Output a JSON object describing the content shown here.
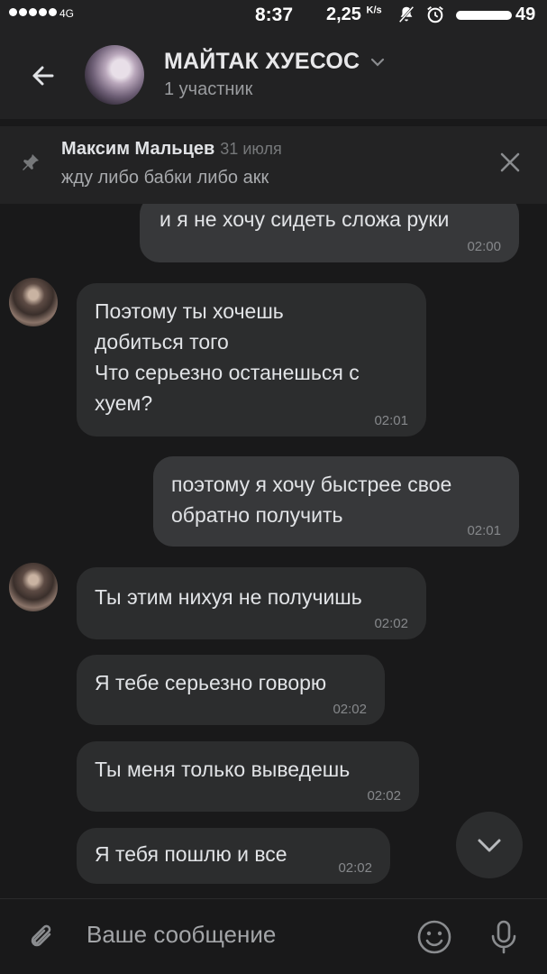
{
  "status_bar": {
    "network": "4G",
    "time": "8:37",
    "speed": "2,25",
    "speed_unit": "K/s",
    "battery": "49"
  },
  "header": {
    "title": "МАЙТАК ХУЕСОС",
    "subtitle": "1 участник"
  },
  "pinned": {
    "author": "Максим Мальцев",
    "date": "31 июля",
    "text": "жду либо бабки либо акк"
  },
  "messages": [
    {
      "dir": "out",
      "text": "и я не хочу сидеть сложа руки",
      "time": "02:00"
    },
    {
      "dir": "in",
      "text": "Поэтому ты хочешь\nдобиться того\nЧто серьезно останешься с\nхуем?",
      "time": "02:01"
    },
    {
      "dir": "out",
      "text": "поэтому я хочу быстрее свое\nобратно получить",
      "time": "02:01"
    },
    {
      "dir": "in",
      "text": "Ты этим нихуя не получишь",
      "time": "02:02"
    },
    {
      "dir": "in",
      "text": "Я тебе серьезно говорю",
      "time": "02:02"
    },
    {
      "dir": "in",
      "text": "Ты меня только выведешь",
      "time": "02:02"
    },
    {
      "dir": "in",
      "text": "Я тебя пошлю и все",
      "time": "02:02"
    }
  ],
  "input": {
    "placeholder": "Ваше сообщение"
  },
  "colors": {
    "background": "#19191a",
    "bar": "#222223",
    "bubble_in": "#2c2d2e",
    "bubble_out": "#37383a",
    "text": "#e1e3e6",
    "muted": "#86888b"
  },
  "icons": [
    "back-arrow-icon",
    "chevron-down-icon",
    "pin-icon",
    "close-icon",
    "attach-icon",
    "emoji-icon",
    "mic-icon"
  ]
}
